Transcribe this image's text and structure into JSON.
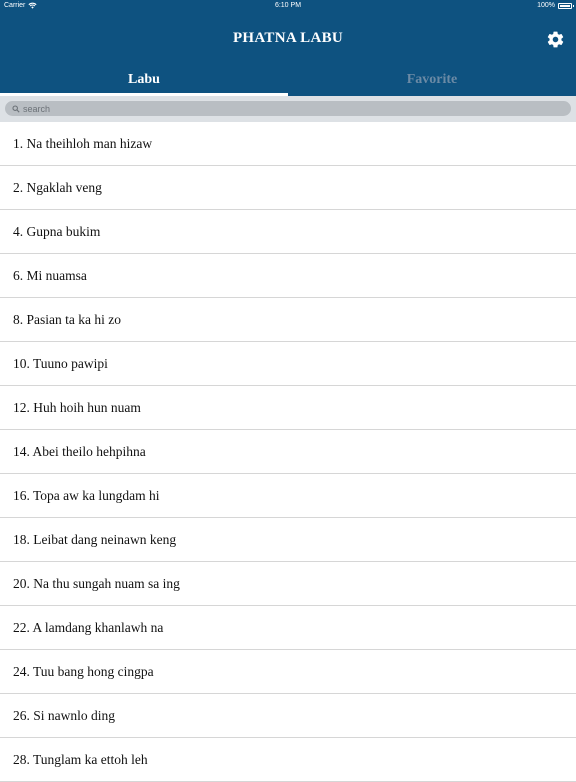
{
  "status_bar": {
    "carrier": "Carrier",
    "time": "6:10 PM",
    "battery": "100%",
    "battery_level": 1.0
  },
  "header": {
    "title": "PHATNA LABU",
    "background_color": "#0e5280",
    "settings_icon": "gear-icon"
  },
  "tabs": [
    {
      "label": "Labu",
      "active": true
    },
    {
      "label": "Favorite",
      "active": false
    }
  ],
  "search": {
    "placeholder": "search",
    "value": "",
    "icon": "search-icon"
  },
  "songs": [
    {
      "label": "1. Na theihloh man hizaw"
    },
    {
      "label": "2. Ngaklah veng"
    },
    {
      "label": "4. Gupna bukim"
    },
    {
      "label": "6. Mi nuamsa"
    },
    {
      "label": "8. Pasian ta ka hi zo"
    },
    {
      "label": "10. Tuuno pawipi"
    },
    {
      "label": "12. Huh hoih hun nuam"
    },
    {
      "label": "14. Abei theilo hehpihna"
    },
    {
      "label": "16. Topa aw ka lungdam hi"
    },
    {
      "label": "18. Leibat dang neinawn keng"
    },
    {
      "label": "20. Na thu sungah nuam sa ing"
    },
    {
      "label": "22. A lamdang khanlawh na"
    },
    {
      "label": "24. Tuu bang hong cingpa"
    },
    {
      "label": "26. Si nawnlo ding"
    },
    {
      "label": "28. Tunglam ka ettoh leh"
    }
  ]
}
